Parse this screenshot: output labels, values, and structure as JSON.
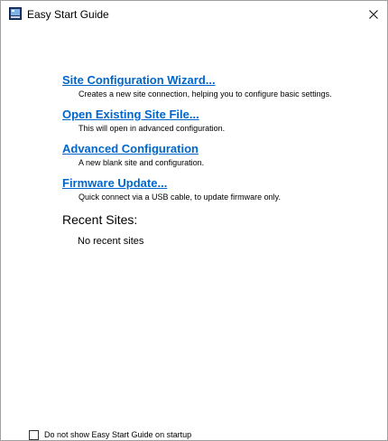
{
  "window": {
    "title": "Easy Start Guide",
    "icon": "app-window-icon",
    "close_icon": "close-icon"
  },
  "entries": [
    {
      "link": "Site Configuration Wizard...",
      "description": "Creates a new site connection, helping you to configure basic settings."
    },
    {
      "link": "Open Existing Site File...",
      "description": "This will open in advanced configuration."
    },
    {
      "link": "Advanced Configuration",
      "description": "A new blank site and configuration."
    },
    {
      "link": "Firmware Update...",
      "description": "Quick connect via a USB cable, to update firmware only."
    }
  ],
  "recent": {
    "heading": "Recent Sites:",
    "empty_text": "No recent sites"
  },
  "footer": {
    "checkbox_label": "Do not show Easy Start Guide on startup",
    "checked": false
  },
  "colors": {
    "link": "#0066cc",
    "border": "#a0a0a0"
  }
}
